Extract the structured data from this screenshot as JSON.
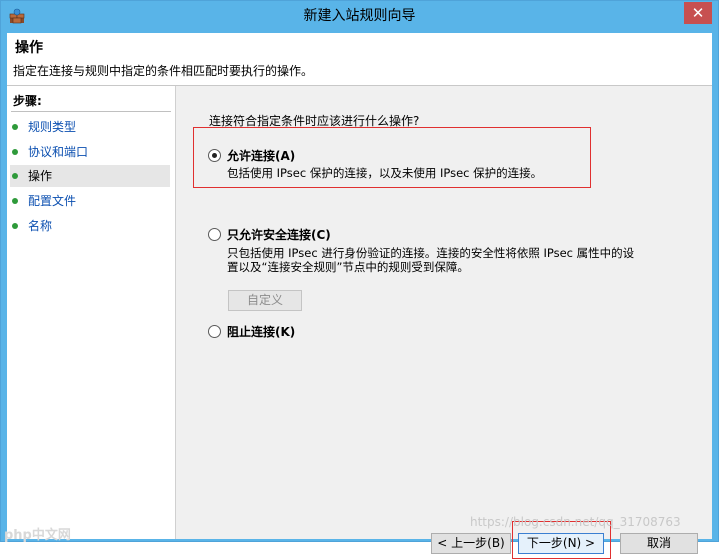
{
  "window": {
    "title": "新建入站规则向导",
    "close_glyph": "✕"
  },
  "header": {
    "title": "操作",
    "description": "指定在连接与规则中指定的条件相匹配时要执行的操作。"
  },
  "sidebar": {
    "steps_label": "步骤:",
    "items": [
      {
        "label": "规则类型",
        "current": false
      },
      {
        "label": "协议和端口",
        "current": false
      },
      {
        "label": "操作",
        "current": true
      },
      {
        "label": "配置文件",
        "current": false
      },
      {
        "label": "名称",
        "current": false
      }
    ]
  },
  "main": {
    "question": "连接符合指定条件时应该进行什么操作?",
    "options": [
      {
        "label": "允许连接(A)",
        "description": "包括使用 IPsec 保护的连接，以及未使用 IPsec 保护的连接。",
        "checked": true
      },
      {
        "label": "只允许安全连接(C)",
        "description_line1": "只包括使用 IPsec 进行身份验证的连接。连接的安全性将依照 IPsec 属性中的设",
        "description_line2": "置以及“连接安全规则”节点中的规则受到保障。",
        "checked": false,
        "customize_label": "自定义"
      },
      {
        "label": "阻止连接(K)",
        "checked": false
      }
    ]
  },
  "buttons": {
    "back": "< 上一步(B)",
    "next": "下一步(N) >",
    "cancel": "取消"
  },
  "watermark": "https://blog.csdn.net/qq_31708763",
  "logo_text": "php中文网",
  "colors": {
    "titlebar": "#59b4e8",
    "close": "#c75050",
    "highlight": "#e03030",
    "link": "#0b4fb0",
    "step_dot": "#2e9a3a"
  }
}
